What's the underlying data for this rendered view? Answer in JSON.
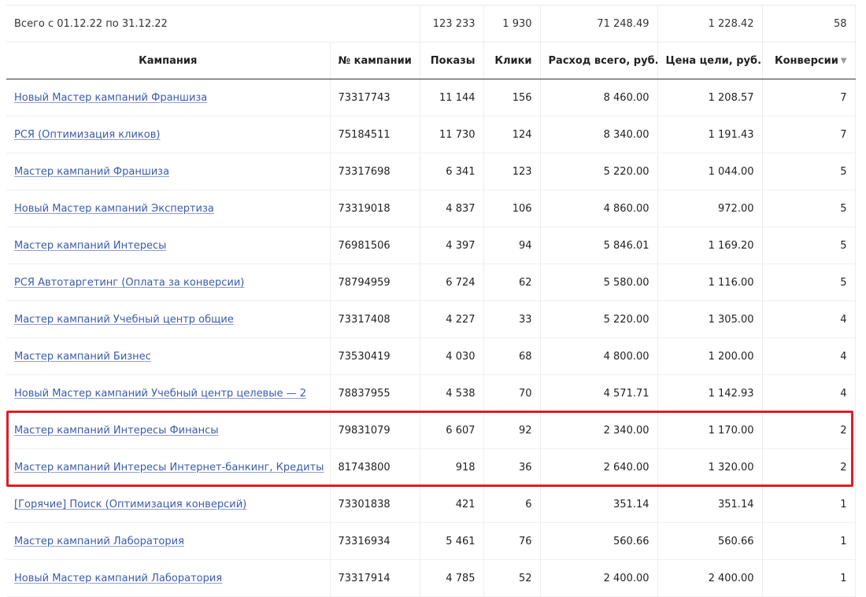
{
  "totals": {
    "label": "Всего с 01.12.22 по 31.12.22",
    "shows": "123 233",
    "clicks": "1 930",
    "spend": "71 248.49",
    "goal_price": "1 228.42",
    "conversions": "58"
  },
  "columns": {
    "campaign": "Кампания",
    "number": "№ кампании",
    "shows": "Показы",
    "clicks": "Клики",
    "spend": "Расход всего, руб.",
    "goal_price": "Цена цели, руб.",
    "conversions": "Конверсии"
  },
  "sort": {
    "column": "conversions",
    "direction": "desc",
    "icon": "sort-desc-icon"
  },
  "rows": [
    {
      "name": "Новый Мастер кампаний Франшиза",
      "number": "73317743",
      "shows": "11 144",
      "clicks": "156",
      "spend": "8 460.00",
      "goal_price": "1 208.57",
      "conversions": "7"
    },
    {
      "name": "РСЯ (Оптимизация кликов)",
      "number": "75184511",
      "shows": "11 730",
      "clicks": "124",
      "spend": "8 340.00",
      "goal_price": "1 191.43",
      "conversions": "7"
    },
    {
      "name": "Мастер кампаний Франшиза",
      "number": "73317698",
      "shows": "6 341",
      "clicks": "123",
      "spend": "5 220.00",
      "goal_price": "1 044.00",
      "conversions": "5"
    },
    {
      "name": "Новый Мастер кампаний Экспертиза",
      "number": "73319018",
      "shows": "4 837",
      "clicks": "106",
      "spend": "4 860.00",
      "goal_price": "972.00",
      "conversions": "5"
    },
    {
      "name": "Мастер кампаний Интересы",
      "number": "76981506",
      "shows": "4 397",
      "clicks": "94",
      "spend": "5 846.01",
      "goal_price": "1 169.20",
      "conversions": "5"
    },
    {
      "name": "РСЯ Автотаргетинг (Оплата за конверсии)",
      "number": "78794959",
      "shows": "6 724",
      "clicks": "62",
      "spend": "5 580.00",
      "goal_price": "1 116.00",
      "conversions": "5"
    },
    {
      "name": "Мастер кампаний Учебный центр общие",
      "number": "73317408",
      "shows": "4 227",
      "clicks": "33",
      "spend": "5 220.00",
      "goal_price": "1 305.00",
      "conversions": "4"
    },
    {
      "name": "Мастер кампаний Бизнес",
      "number": "73530419",
      "shows": "4 030",
      "clicks": "68",
      "spend": "4 800.00",
      "goal_price": "1 200.00",
      "conversions": "4"
    },
    {
      "name": "Новый Мастер кампаний Учебный центр целевые — 2",
      "number": "78837955",
      "shows": "4 538",
      "clicks": "70",
      "spend": "4 571.71",
      "goal_price": "1 142.93",
      "conversions": "4"
    },
    {
      "name": "Мастер кампаний Интересы Финансы",
      "number": "79831079",
      "shows": "6 607",
      "clicks": "92",
      "spend": "2 340.00",
      "goal_price": "1 170.00",
      "conversions": "2"
    },
    {
      "name": "Мастер кампаний Интересы Интернет-банкинг, Кредиты",
      "number": "81743800",
      "shows": "918",
      "clicks": "36",
      "spend": "2 640.00",
      "goal_price": "1 320.00",
      "conversions": "2"
    },
    {
      "name": "[Горячие] Поиск (Оптимизация конверсий)",
      "number": "73301838",
      "shows": "421",
      "clicks": "6",
      "spend": "351.14",
      "goal_price": "351.14",
      "conversions": "1"
    },
    {
      "name": "Мастер кампаний Лаборатория",
      "number": "73316934",
      "shows": "5 461",
      "clicks": "76",
      "spend": "560.66",
      "goal_price": "560.66",
      "conversions": "1"
    },
    {
      "name": "Новый Мастер кампаний Лаборатория",
      "number": "73317914",
      "shows": "4 785",
      "clicks": "52",
      "spend": "2 400.00",
      "goal_price": "2 400.00",
      "conversions": "1"
    }
  ],
  "highlight": {
    "color": "#e21b25",
    "rows": [
      9,
      10
    ]
  },
  "colors": {
    "link": "#3b5bb0",
    "header_rule": "#333333",
    "grid_line": "#ececec"
  }
}
